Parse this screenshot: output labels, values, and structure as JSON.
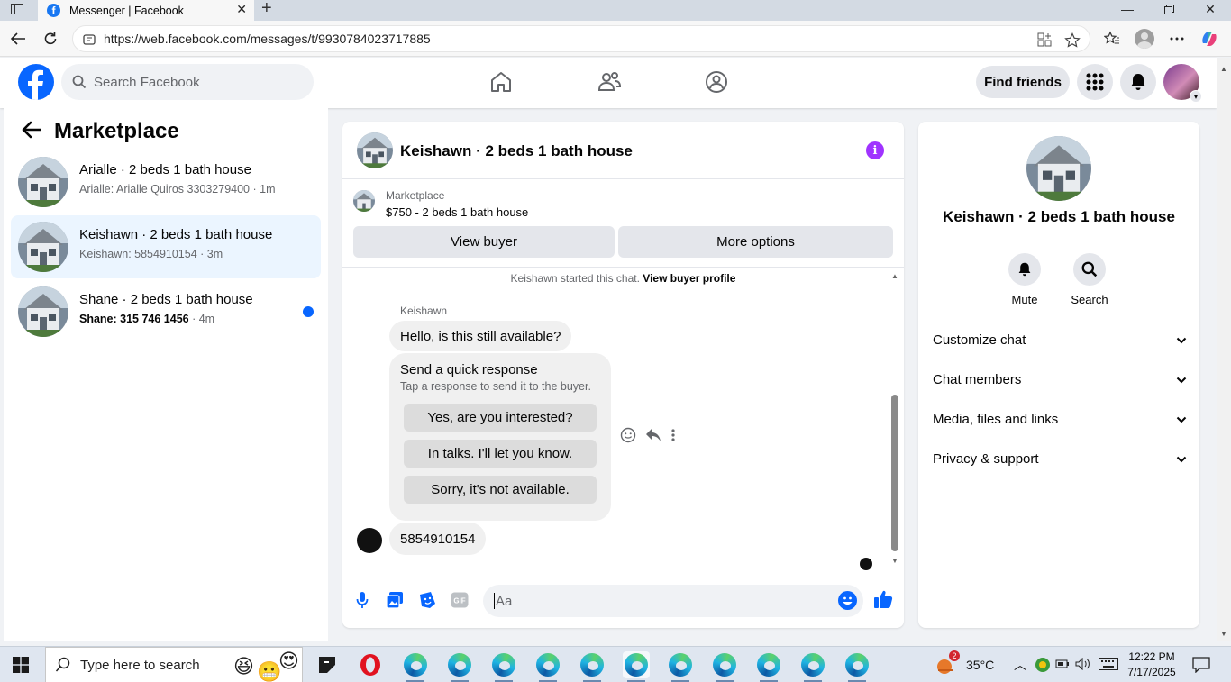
{
  "browser": {
    "tab_title": "Messenger | Facebook",
    "url": "https://web.facebook.com/messages/t/9930784023717885"
  },
  "header": {
    "search_placeholder": "Search Facebook",
    "find_friends": "Find friends"
  },
  "sidebar": {
    "title": "Marketplace",
    "threads": [
      {
        "title": "Arialle · 2 beds 1 bath house",
        "subtitle": "Arialle: Arialle Quiros 3303279400 · 1m",
        "unread": false,
        "active": false
      },
      {
        "title": "Keishawn · 2 beds 1 bath house",
        "subtitle": "Keishawn: 5854910154 · 3m",
        "unread": false,
        "active": true
      },
      {
        "title": "Shane · 2 beds 1 bath house",
        "subtitle": "Shane: 315 746 1456",
        "time": " · 4m",
        "unread": true,
        "active": false
      }
    ]
  },
  "chat": {
    "title": "Keishawn · 2 beds 1 bath house",
    "listing": {
      "source": "Marketplace",
      "price_title": "$750 - 2 beds 1 bath house",
      "view_buyer": "View buyer",
      "more_options": "More options"
    },
    "started_text": "Keishawn started this chat.",
    "view_buyer_profile": "View buyer profile",
    "sender_name": "Keishawn",
    "first_message": "Hello, is this still available?",
    "quick_response": {
      "title": "Send a quick response",
      "subtitle": "Tap a response to send it to the buyer.",
      "options": [
        "Yes, are you interested?",
        "In talks. I'll let you know.",
        "Sorry, it's not available."
      ]
    },
    "second_message": "5854910154",
    "composer_placeholder": "Aa"
  },
  "details": {
    "title": "Keishawn · 2 beds 1 bath house",
    "actions": [
      "Mute",
      "Search"
    ],
    "sections": [
      "Customize chat",
      "Chat members",
      "Media, files and links",
      "Privacy & support"
    ]
  },
  "taskbar": {
    "search_placeholder": "Type here to search",
    "temperature": "35°C",
    "time": "12:22 PM",
    "date": "7/17/2025",
    "weather_badge": "2"
  },
  "colors": {
    "fb_blue": "#0866ff",
    "active_thread_bg": "#ebf5ff",
    "info_purple": "#a033ff"
  }
}
